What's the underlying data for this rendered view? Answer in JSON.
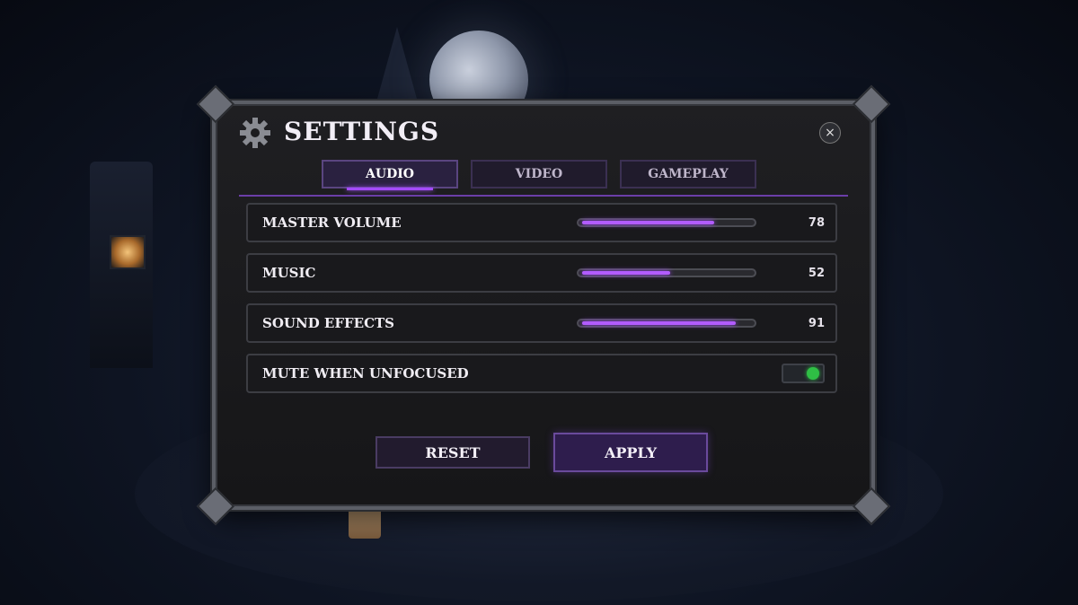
{
  "window": {
    "title": "SETTINGS",
    "close_icon": "×"
  },
  "tabs": [
    {
      "label": "AUDIO",
      "active": true
    },
    {
      "label": "VIDEO",
      "active": false
    },
    {
      "label": "GAMEPLAY",
      "active": false
    }
  ],
  "audio": {
    "master_volume": {
      "label": "MASTER VOLUME",
      "value": "78",
      "fraction": 0.78
    },
    "music": {
      "label": "MUSIC",
      "value": "52",
      "fraction": 0.52
    },
    "sound_effects": {
      "label": "SOUND EFFECTS",
      "value": "91",
      "fraction": 0.91
    },
    "mute_when_unfocused": {
      "label": "MUTE WHEN UNFOCUSED",
      "enabled": true
    }
  },
  "buttons": {
    "reset": "RESET",
    "apply": "APPLY"
  },
  "colors": {
    "accent": "#a44bff",
    "toggle_on": "#2fbf45"
  }
}
